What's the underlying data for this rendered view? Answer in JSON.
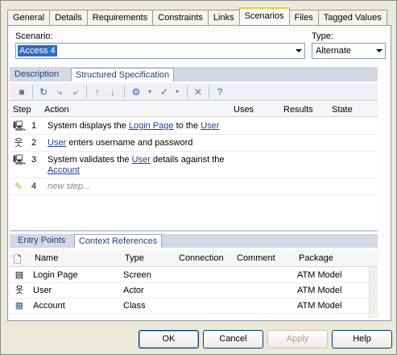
{
  "tabs": [
    "General",
    "Details",
    "Requirements",
    "Constraints",
    "Links",
    "Scenarios",
    "Files",
    "Tagged Values"
  ],
  "active_tab": "Scenarios",
  "scenario": {
    "label": "Scenario:",
    "value": "Access 4"
  },
  "type": {
    "label": "Type:",
    "value": "Alternate"
  },
  "subtabs": [
    "Description",
    "Structured Specification"
  ],
  "steps_header": {
    "step": "Step",
    "action": "Action",
    "uses": "Uses",
    "results": "Results",
    "state": "State"
  },
  "steps": [
    {
      "num": "1",
      "icon": "computer-icon",
      "parts": [
        [
          "System displays the ",
          false
        ],
        [
          "Login Page",
          true
        ],
        [
          " to the ",
          false
        ],
        [
          "User",
          true
        ]
      ]
    },
    {
      "num": "2",
      "icon": "actor-icon",
      "parts": [
        [
          "User",
          true
        ],
        [
          " enters username and password",
          false
        ]
      ]
    },
    {
      "num": "3",
      "icon": "computer-icon",
      "parts": [
        [
          "System validates the ",
          false
        ],
        [
          "User",
          true
        ],
        [
          " details against the ",
          false
        ],
        [
          "Account",
          true
        ]
      ]
    },
    {
      "num": "4",
      "icon": "new-step-icon",
      "new_step": "new step..."
    }
  ],
  "ctx_tabs": [
    "Entry Points",
    "Context References"
  ],
  "ctx_header": {
    "name": "Name",
    "type": "Type",
    "connection": "Connection",
    "comment": "Comment",
    "package": "Package"
  },
  "ctx_rows": [
    {
      "name": "Login Page",
      "type": "Screen",
      "connection": "",
      "comment": "",
      "package": "ATM Model"
    },
    {
      "name": "User",
      "type": "Actor",
      "connection": "",
      "comment": "",
      "package": "ATM Model"
    },
    {
      "name": "Account",
      "type": "Class",
      "connection": "",
      "comment": "",
      "package": "ATM Model"
    }
  ],
  "buttons": {
    "ok": "OK",
    "cancel": "Cancel",
    "apply": "Apply",
    "help": "Help"
  }
}
